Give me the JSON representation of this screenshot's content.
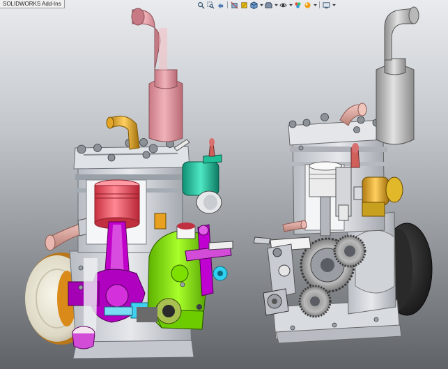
{
  "window": {
    "panel_tab": "SOLIDWORKS Add-Ins"
  },
  "heads_up_toolbar": {
    "buttons": [
      "zoom-to-fit",
      "zoom-to-area",
      "previous-view",
      "section-view",
      "dynamic-annotation-views",
      "view-orientation",
      "display-style",
      "hide-show-items",
      "edit-appearance",
      "apply-scene",
      "view-settings"
    ]
  },
  "colors": {
    "background_top": "#e9ebee",
    "background_bottom": "#5f6367",
    "engine_body": "#d6d9de",
    "piston": "#ff5a6e",
    "exhaust_pipe": "#e8a0a8",
    "connecting_rod": "#c000c8",
    "gear_cover": "#8cf000",
    "carburetor": "#20c8a0",
    "fuel_pipe": "#e8b020",
    "flywheel_face": "#eae6d4",
    "flywheel_rim": "#d88a18",
    "second_exhaust": "#c8c8c8",
    "brass_part": "#c8a818"
  }
}
